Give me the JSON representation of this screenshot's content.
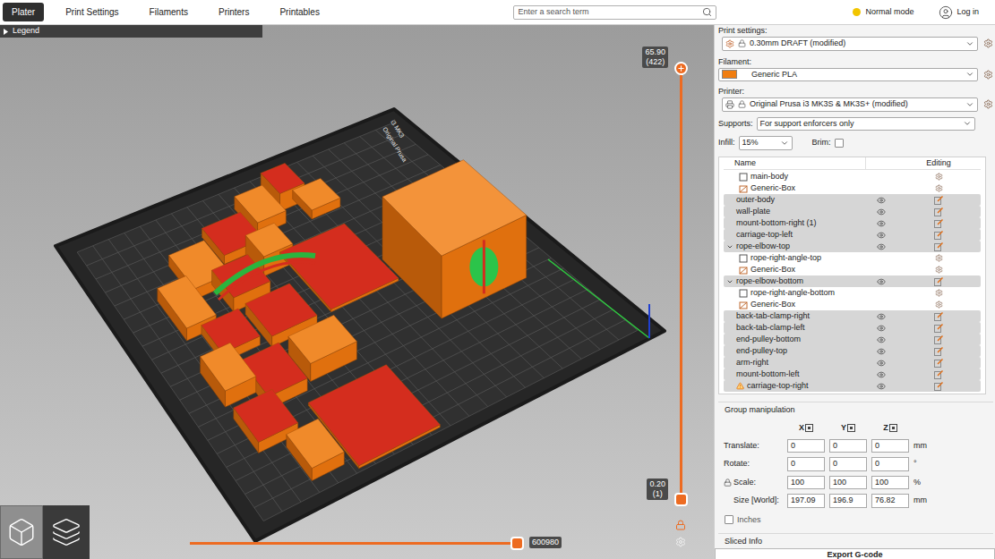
{
  "tabs": [
    {
      "label": "Plater",
      "selected": true
    },
    {
      "label": "Print Settings",
      "selected": false
    },
    {
      "label": "Filaments",
      "selected": false
    },
    {
      "label": "Printers",
      "selected": false
    },
    {
      "label": "Printables",
      "selected": false
    }
  ],
  "search": {
    "placeholder": "Enter a search term"
  },
  "mode": {
    "label": "Normal mode"
  },
  "account": {
    "label": "Log in"
  },
  "legend": {
    "label": "Legend",
    "expanded": false
  },
  "bed_labels": [
    "Original Prusa",
    "i3 MK3"
  ],
  "vertical_slider": {
    "top": {
      "value": "65.90",
      "layer": "(422)",
      "level": 1
    },
    "bottom": {
      "value": "0.20",
      "layer": "(1)",
      "level": 0
    }
  },
  "horizontal_slider": {
    "value": "600980",
    "level": 1
  },
  "presets": {
    "print": {
      "label": "Print settings:",
      "value": "0.30mm DRAFT (modified)"
    },
    "filament": {
      "label": "Filament:",
      "value": "Generic PLA",
      "color": "#f07d10"
    },
    "printer": {
      "label": "Printer:",
      "value": "Original Prusa i3 MK3S & MK3S+ (modified)"
    }
  },
  "supports": {
    "label": "Supports:",
    "value": "For support enforcers only"
  },
  "infill": {
    "label": "Infill:",
    "value": "15%"
  },
  "brim": {
    "label": "Brim:",
    "checked": false
  },
  "object_list": {
    "columns": [
      "Name",
      "Editing"
    ],
    "rows": [
      {
        "name": "main-body",
        "kind": "part",
        "depth": 1,
        "selected": false,
        "expanded": false,
        "warning": false
      },
      {
        "name": "Generic-Box",
        "kind": "modifier",
        "depth": 1,
        "selected": false,
        "expanded": false,
        "warning": false
      },
      {
        "name": "outer-body",
        "kind": "object",
        "depth": 0,
        "selected": true,
        "expanded": false,
        "warning": false
      },
      {
        "name": "wall-plate",
        "kind": "object",
        "depth": 0,
        "selected": true,
        "expanded": false,
        "warning": false
      },
      {
        "name": "mount-bottom-right (1)",
        "kind": "object",
        "depth": 0,
        "selected": true,
        "expanded": false,
        "warning": false
      },
      {
        "name": "carriage-top-left",
        "kind": "object",
        "depth": 0,
        "selected": true,
        "expanded": false,
        "warning": false
      },
      {
        "name": "rope-elbow-top",
        "kind": "object",
        "depth": 0,
        "selected": true,
        "expanded": true,
        "warning": false
      },
      {
        "name": "rope-right-angle-top",
        "kind": "part",
        "depth": 1,
        "selected": false,
        "expanded": false,
        "warning": false
      },
      {
        "name": "Generic-Box",
        "kind": "modifier",
        "depth": 1,
        "selected": false,
        "expanded": false,
        "warning": false
      },
      {
        "name": "rope-elbow-bottom",
        "kind": "object",
        "depth": 0,
        "selected": true,
        "expanded": true,
        "warning": false
      },
      {
        "name": "rope-right-angle-bottom",
        "kind": "part",
        "depth": 1,
        "selected": false,
        "expanded": false,
        "warning": false
      },
      {
        "name": "Generic-Box",
        "kind": "modifier",
        "depth": 1,
        "selected": false,
        "expanded": false,
        "warning": false
      },
      {
        "name": "back-tab-clamp-right",
        "kind": "object",
        "depth": 0,
        "selected": true,
        "expanded": false,
        "warning": false
      },
      {
        "name": "back-tab-clamp-left",
        "kind": "object",
        "depth": 0,
        "selected": true,
        "expanded": false,
        "warning": false
      },
      {
        "name": "end-pulley-bottom",
        "kind": "object",
        "depth": 0,
        "selected": true,
        "expanded": false,
        "warning": false
      },
      {
        "name": "end-pulley-top",
        "kind": "object",
        "depth": 0,
        "selected": true,
        "expanded": false,
        "warning": false
      },
      {
        "name": "arm-right",
        "kind": "object",
        "depth": 0,
        "selected": true,
        "expanded": false,
        "warning": false
      },
      {
        "name": "mount-bottom-left",
        "kind": "object",
        "depth": 0,
        "selected": true,
        "expanded": false,
        "warning": false
      },
      {
        "name": "carriage-top-right",
        "kind": "object",
        "depth": 0,
        "selected": true,
        "expanded": false,
        "warning": true
      }
    ]
  },
  "manipulation": {
    "title": "Group manipulation",
    "axes": [
      "X",
      "Y",
      "Z"
    ],
    "scale_lock": {
      "locked": true
    },
    "rows": [
      {
        "label": "Translate:",
        "values": [
          "0",
          "0",
          "0"
        ],
        "unit": "mm"
      },
      {
        "label": "Rotate:",
        "values": [
          "0",
          "0",
          "0"
        ],
        "unit": "°"
      },
      {
        "label": "Scale:",
        "values": [
          "100",
          "100",
          "100"
        ],
        "unit": "%"
      },
      {
        "label": "Size [World]:",
        "values": [
          "197.09",
          "196.9",
          "76.82"
        ],
        "unit": "mm"
      }
    ],
    "inches": {
      "label": "Inches",
      "checked": false
    }
  },
  "sliced_info": {
    "label": "Sliced Info"
  },
  "export_button": {
    "label": "Export G-code"
  }
}
